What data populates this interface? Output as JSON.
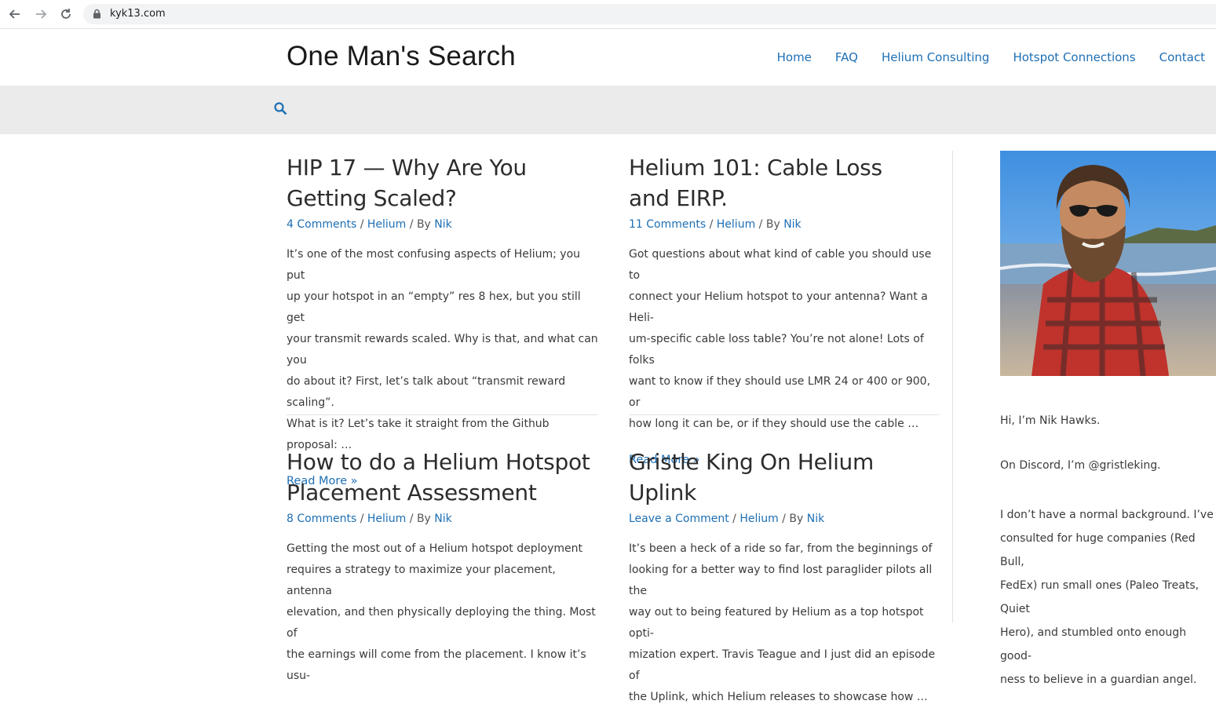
{
  "browser": {
    "url": "kyk13.com"
  },
  "site": {
    "title": "One Man's Search",
    "menu": [
      "Home",
      "FAQ",
      "Helium Consulting",
      "Hotspot Connections",
      "Contact"
    ]
  },
  "posts": [
    {
      "title_lines": [
        "HIP 17 — Why Are You",
        "Getting Scaled?"
      ],
      "comments": "4 Comments",
      "category": "Helium",
      "author": "Nik",
      "excerpt": [
        "It’s one of the most confusing aspects of Helium; you put",
        "up your hotspot in an “empty” res 8 hex, but you still get",
        "your transmit rewards scaled. Why is that, and what can you",
        "do about it? First, let’s talk about “transmit reward scaling”.",
        "What is it? Let’s take it straight from the Github proposal: …"
      ],
      "read_more": "Read More »"
    },
    {
      "title_lines": [
        "Helium 101: Cable Loss",
        "and EIRP."
      ],
      "comments": "11 Comments",
      "category": "Helium",
      "author": "Nik",
      "excerpt": [
        "Got questions about what kind of cable you should use to",
        "connect your Helium hotspot to your antenna? Want a Heli-",
        "um-specific cable loss table? You’re not alone! Lots of folks",
        "want to know if they should use LMR 24 or 400 or 900, or",
        "how long it can be, or if they should use the cable …"
      ],
      "read_more": "Read More »"
    },
    {
      "title_lines": [
        "How to do a Helium Hotspot",
        "Placement Assessment"
      ],
      "comments": "8 Comments",
      "category": "Helium",
      "author": "Nik",
      "excerpt": [
        "Getting the most out of a Helium hotspot deployment",
        "requires a strategy to maximize your placement, antenna",
        "elevation, and then physically deploying the thing.  Most of",
        "the earnings will come from the placement. I know it’s usu-"
      ],
      "read_more": ""
    },
    {
      "title_lines": [
        "Gristle King On Helium Uplink"
      ],
      "comments": "Leave a Comment",
      "category": "Helium",
      "author": "Nik",
      "excerpt": [
        "It’s been a heck of a ride so far, from the beginnings of",
        "looking for a better way to find lost paraglider pilots all the",
        "way out to being featured by Helium as a top hotspot opti-",
        "mization expert.  Travis Teague and I just did an episode of",
        "the Uplink, which Helium releases to showcase how …"
      ],
      "read_more": ""
    }
  ],
  "meta_sep": " / ",
  "meta_by": "By ",
  "sidebar": {
    "intro": "Hi, I’m Nik Hawks.",
    "discord": "On Discord, I’m @gristleking.",
    "background_lines": [
      "I don’t have a normal background. I’ve",
      "consulted for huge companies (Red Bull,",
      "FedEx) run small ones (Paleo Treats, Quiet",
      "Hero), and stumbled onto enough good-",
      "ness to believe in a guardian angel."
    ]
  },
  "colors": {
    "link": "#1e6fb3",
    "search_bar_bg": "#ebebeb"
  }
}
